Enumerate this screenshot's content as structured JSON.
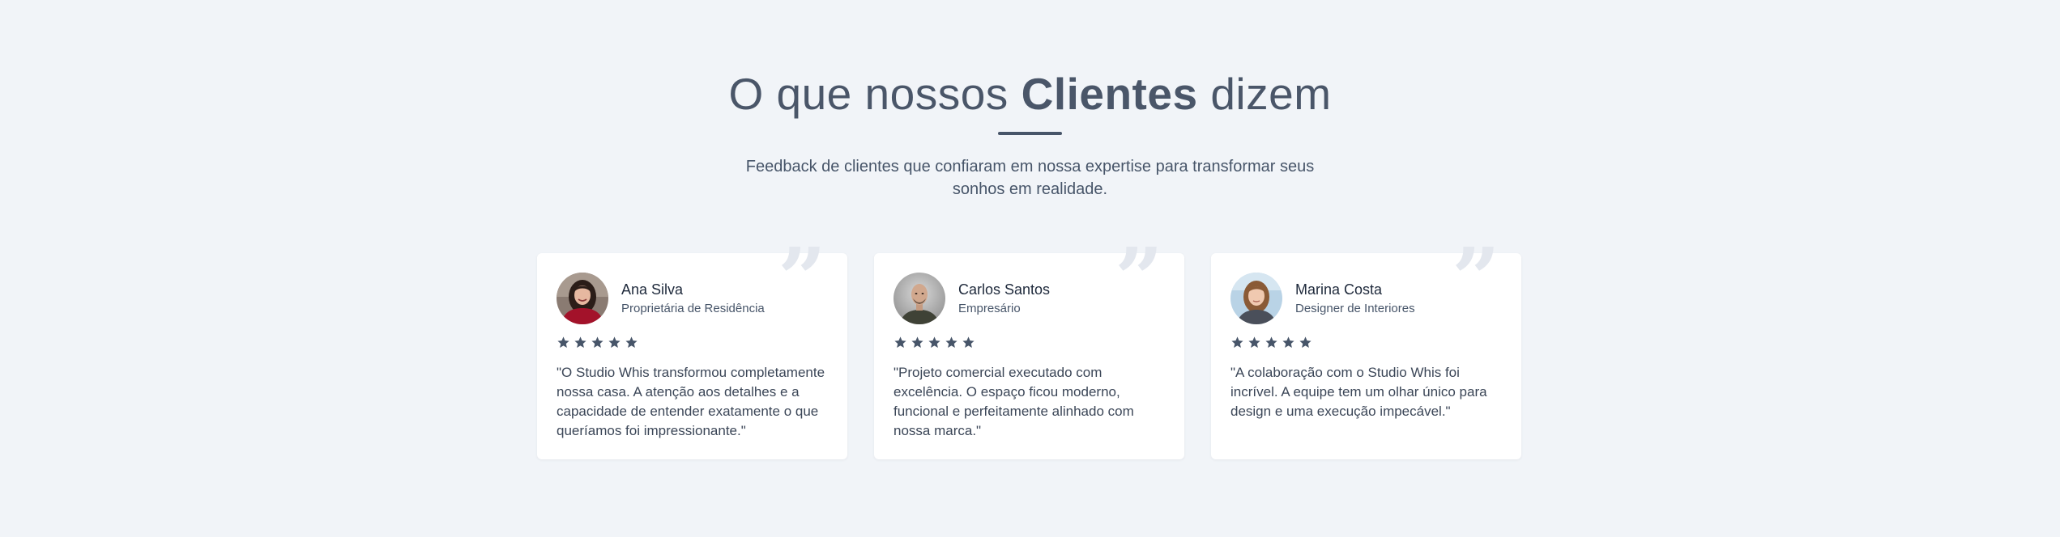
{
  "section": {
    "title_pre": "O que nossos ",
    "title_bold": "Clientes",
    "title_post": " dizem",
    "subtitle": "Feedback de clientes que confiaram em nossa expertise para transformar seus sonhos em realidade."
  },
  "colors": {
    "background": "#f1f4f8",
    "card": "#ffffff",
    "heading": "#4a5669",
    "star": "#475569",
    "quote_mark": "#e3e7ee"
  },
  "testimonials": [
    {
      "name": "Ana Silva",
      "role": "Proprietária de Residência",
      "rating": 5,
      "text": "\"O Studio Whis transformou completamente nossa casa. A atenção aos detalhes e a capacidade de entender exatamente o que queríamos foi impressionante.\"",
      "avatar": "avatar-photo-woman-dark-hair"
    },
    {
      "name": "Carlos Santos",
      "role": "Empresário",
      "rating": 5,
      "text": "\"Projeto comercial executado com excelência. O espaço ficou moderno, funcional e perfeitamente alinhado com nossa marca.\"",
      "avatar": "avatar-photo-bald-man"
    },
    {
      "name": "Marina Costa",
      "role": "Designer de Interiores",
      "rating": 5,
      "text": "\"A colaboração com o Studio Whis foi incrível. A equipe tem um olhar único para design e uma execução impecável.\"",
      "avatar": "avatar-photo-woman-light-hair"
    }
  ]
}
